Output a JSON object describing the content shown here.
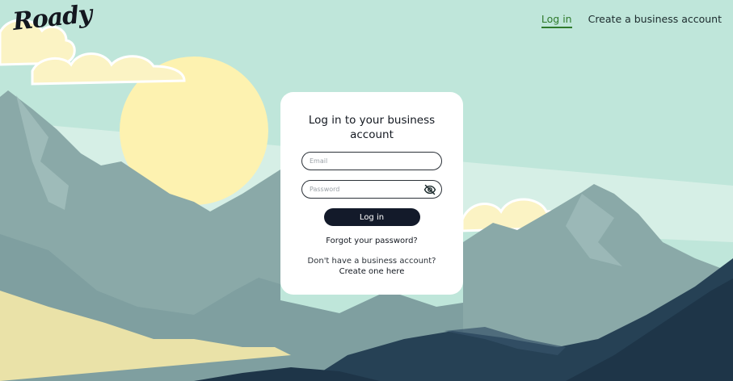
{
  "brand": {
    "logo_text": "Roady"
  },
  "nav": {
    "login_label": "Log in",
    "create_label": "Create a business account"
  },
  "card": {
    "title": "Log in to your business account",
    "email_placeholder": "Email",
    "password_placeholder": "Password",
    "login_button": "Log in",
    "forgot_link": "Forgot your password?",
    "no_account_text": "Don't have a business account?",
    "create_link": "Create one here"
  },
  "icons": {
    "password_toggle": "eye-slash-icon"
  },
  "colors": {
    "sky": "#bfe6da",
    "sun": "#fdf2b0",
    "mountain_light": "#8aa9a8",
    "mountain_dark": "#264155",
    "button": "#131a2a",
    "nav_active": "#2f7a2c"
  }
}
